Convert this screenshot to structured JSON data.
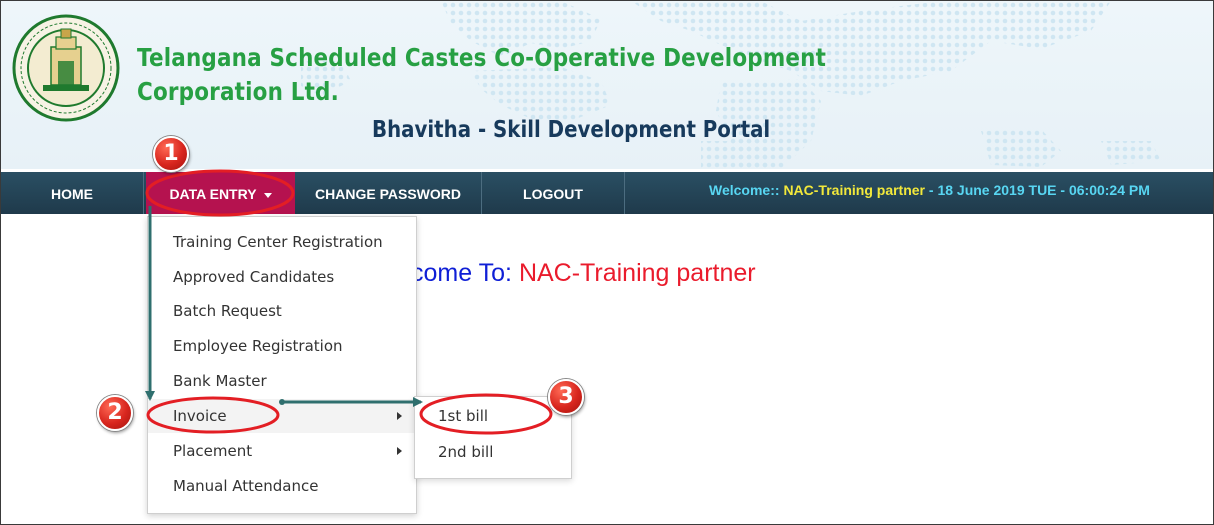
{
  "header": {
    "title": "Telangana Scheduled Castes Co-Operative Development Corporation Ltd.",
    "subtitle": "Bhavitha - Skill Development Portal",
    "seal_icon": "government-of-telangana-seal-icon"
  },
  "nav": {
    "home": "HOME",
    "data_entry": "DATA ENTRY",
    "change_password": "CHANGE PASSWORD",
    "logout": "LOGOUT",
    "welcome_label": "Welcome:: ",
    "welcome_user": "NAC-Training partner",
    "welcome_date": " - 18 June 2019 TUE - 06:00:24 PM"
  },
  "main": {
    "welcome_prefix": "come To: ",
    "welcome_name": "NAC-Training partner"
  },
  "menu": {
    "items": [
      {
        "label": "Training Center Registration"
      },
      {
        "label": "Approved Candidates"
      },
      {
        "label": "Batch Request"
      },
      {
        "label": "Employee Registration"
      },
      {
        "label": "Bank Master"
      },
      {
        "label": "Invoice"
      },
      {
        "label": "Placement"
      },
      {
        "label": "Manual Attendance"
      }
    ]
  },
  "submenu": {
    "items": [
      {
        "label": "1st bill"
      },
      {
        "label": "2nd bill"
      }
    ]
  },
  "annotations": {
    "step1": "1",
    "step2": "2",
    "step3": "3"
  },
  "colors": {
    "title_green": "#27a043",
    "subtitle_navy": "#173a5c",
    "navbar": "#1f3a4b",
    "active_tab": "#b5124f",
    "welcome_cyan": "#58d6f2",
    "welcome_yellow": "#f2e83b",
    "hero_blue": "#0f1fd6",
    "hero_red": "#ea1b2c",
    "annotation_red": "#e31e24",
    "arrow_teal": "#2f6f6e"
  }
}
